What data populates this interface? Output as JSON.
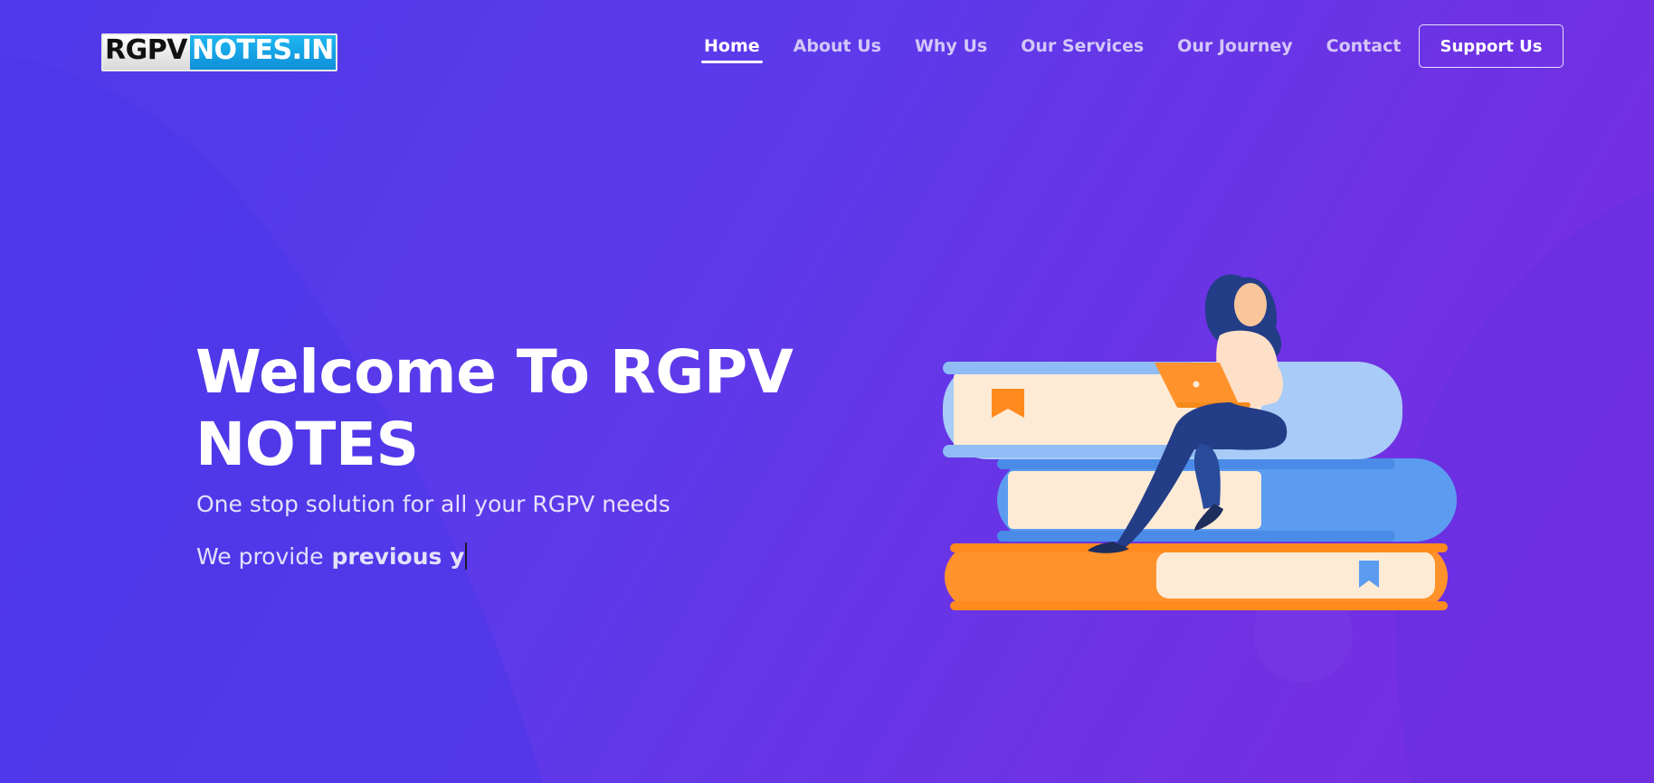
{
  "header": {
    "logo": {
      "part1": "RGPV",
      "part2": "NOTES.IN"
    },
    "nav": [
      {
        "label": "Home",
        "active": true
      },
      {
        "label": "About Us",
        "active": false
      },
      {
        "label": "Why Us",
        "active": false
      },
      {
        "label": "Our Services",
        "active": false
      },
      {
        "label": "Our Journey",
        "active": false
      },
      {
        "label": "Contact",
        "active": false
      }
    ],
    "support_label": "Support Us"
  },
  "hero": {
    "title_line1": "Welcome To RGPV",
    "title_line2": "NOTES",
    "subtitle": "One stop solution for all your RGPV needs",
    "typed_prefix": "We provide",
    "typed_text": "previous y"
  },
  "colors": {
    "bg_start": "#4f39ea",
    "bg_end": "#7a2ce0",
    "accent_orange": "#ff922b",
    "book_blue": "#5b9cf0",
    "book_light_blue": "#a8cbf7",
    "book_page": "#fdebd6",
    "dark_navy": "#233d87"
  },
  "illustration": {
    "icon": "woman-reading-on-books-illustration"
  }
}
